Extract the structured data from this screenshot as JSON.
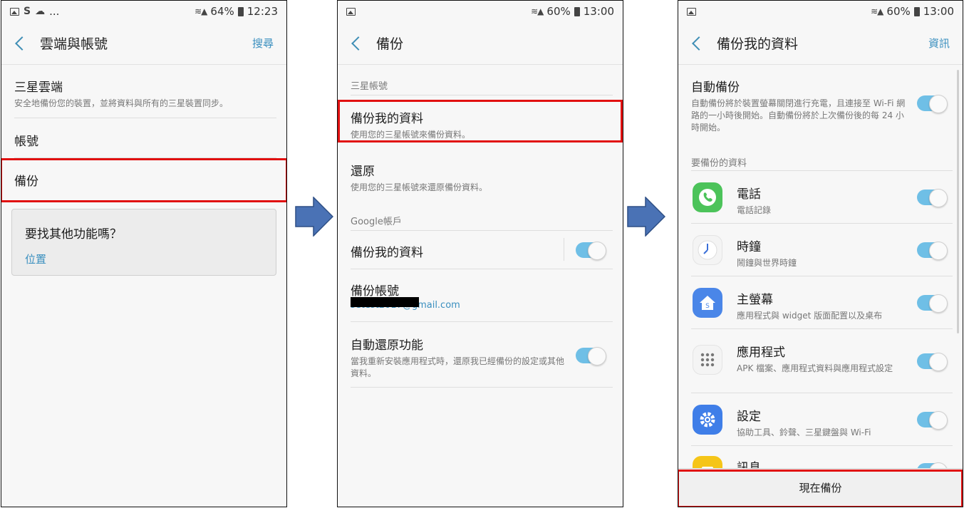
{
  "screen1": {
    "status": {
      "glyph_s": "S",
      "more": "...",
      "signal": "64%",
      "time": "12:23"
    },
    "title": "雲端與帳號",
    "action": "搜尋",
    "items": [
      {
        "title": "三星雲端",
        "subtitle": "安全地備份您的裝置，並將資料與所有的三星裝置同步。"
      },
      {
        "title": "帳號"
      },
      {
        "title": "備份"
      }
    ],
    "card": {
      "title": "要找其他功能嗎？",
      "link": "位置"
    }
  },
  "screen2": {
    "status": {
      "signal": "60%",
      "time": "13:00"
    },
    "title": "備份",
    "section_samsung": "三星帳號",
    "backup_mine": {
      "title": "備份我的資料",
      "subtitle": "使用您的三星帳號來備份資料。"
    },
    "restore": {
      "title": "還原",
      "subtitle": "使用您的三星帳號來還原備份資料。"
    },
    "section_google": "Google帳戶",
    "google_backup": {
      "title": "備份我的資料"
    },
    "backup_account": {
      "title": "備份帳號",
      "email": "setest2017@gmail.com"
    },
    "auto_restore": {
      "title": "自動還原功能",
      "subtitle": "當我重新安裝應用程式時，還原我已經備份的設定或其他資料。"
    }
  },
  "screen3": {
    "status": {
      "signal": "60%",
      "time": "13:00"
    },
    "title": "備份我的資料",
    "action": "資訊",
    "auto_backup": {
      "title": "自動備份",
      "subtitle": "自動備份將於裝置螢幕關閉進行充電，且連接至 Wi-Fi 網路的一小時後開始。自動備份將於上次備份後的每 24 小時開始。"
    },
    "section_data": "要備份的資料",
    "apps": [
      {
        "title": "電話",
        "subtitle": "電話記錄",
        "icon": "phone-icon",
        "color": "#4cc35a"
      },
      {
        "title": "時鐘",
        "subtitle": "鬧鐘與世界時鐘",
        "icon": "clock-icon",
        "color": "#f2f2f2"
      },
      {
        "title": "主螢幕",
        "subtitle": "應用程式與 widget 版面配置以及桌布",
        "icon": "home-icon",
        "color": "#4a86e8"
      },
      {
        "title": "應用程式",
        "subtitle": "APK 檔案、應用程式資料與應用程式設定",
        "icon": "apps-grid-icon",
        "color": "#f2f2f2"
      },
      {
        "title": "設定",
        "subtitle": "協助工具、鈴聲、三星鍵盤與 Wi-Fi",
        "icon": "gear-icon",
        "color": "#3f7ee8"
      },
      {
        "title": "訊息",
        "icon": "message-icon",
        "color": "#f5c518"
      }
    ],
    "button": "現在備份"
  },
  "colors": {
    "accent": "#3a8fbf",
    "toggle": "#6fbfe6",
    "highlight": "#e11010",
    "arrow": "#4a72b5"
  }
}
